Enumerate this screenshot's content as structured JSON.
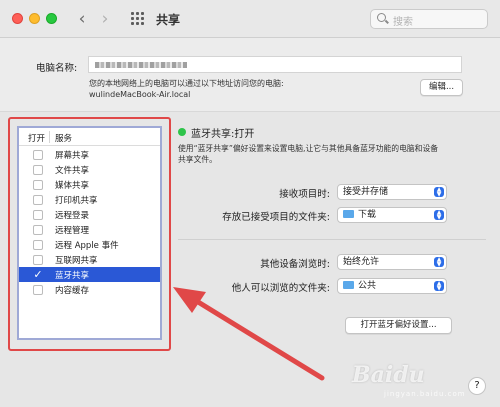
{
  "window": {
    "title": "共享"
  },
  "search": {
    "placeholder": "搜索"
  },
  "computer_name": {
    "label": "电脑名称:",
    "description_line1": "您的本地网络上的电脑可以通过以下地址访问您的电脑:",
    "address": "wulindeMacBook-Air.local",
    "edit_label": "编辑..."
  },
  "services": {
    "col_open": "打开",
    "col_service": "服务",
    "items": [
      {
        "label": "屏幕共享",
        "checked": false
      },
      {
        "label": "文件共享",
        "checked": false
      },
      {
        "label": "媒体共享",
        "checked": false
      },
      {
        "label": "打印机共享",
        "checked": false
      },
      {
        "label": "远程登录",
        "checked": false
      },
      {
        "label": "远程管理",
        "checked": false
      },
      {
        "label": "远程 Apple 事件",
        "checked": false
      },
      {
        "label": "互联网共享",
        "checked": false
      },
      {
        "label": "蓝牙共享",
        "checked": true,
        "selected": true
      },
      {
        "label": "内容缓存",
        "checked": false
      }
    ]
  },
  "bluetooth": {
    "status": "蓝牙共享:打开",
    "status_color": "#2ec44a",
    "info_line1": "使用“蓝牙共享”偏好设置来设置电脑,让它与其他具备蓝牙功能的电脑和设备",
    "info_line2": "共享文件。",
    "receive_label": "接收项目时:",
    "receive_value": "接受并存储",
    "save_label": "存放已接受项目的文件夹:",
    "save_value": "下载",
    "browse_label": "其他设备浏览时:",
    "browse_value": "始终允许",
    "browse_folder_label": "他人可以浏览的文件夹:",
    "browse_folder_value": "公共",
    "open_prefs_label": "打开蓝牙偏好设置..."
  },
  "help": {
    "label": "?"
  },
  "watermark": {
    "text": "Baidu",
    "sub": "jingyan.baidu.com"
  },
  "colors": {
    "annotation_red": "#e04848",
    "selection_blue": "#2a58d6"
  }
}
